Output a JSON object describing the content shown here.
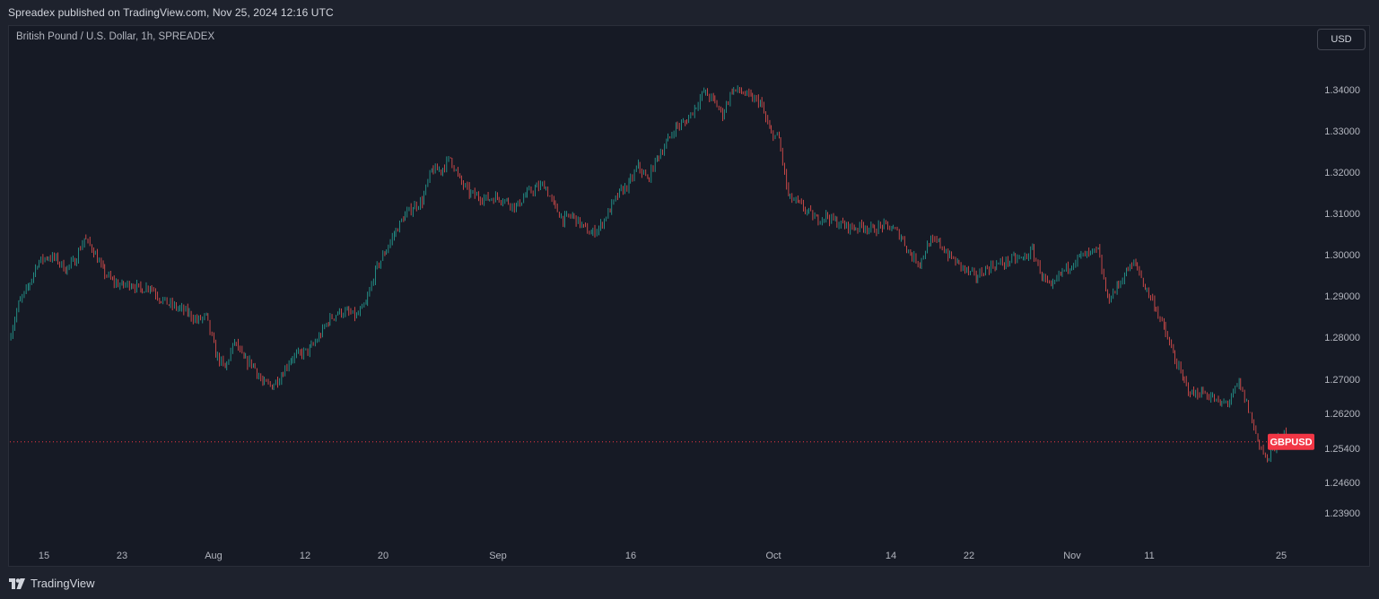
{
  "header": {
    "published": "Spreadex published on TradingView.com, Nov 25, 2024 12:16 UTC"
  },
  "symbol_title": "British Pound / U.S. Dollar, 1h, SPREADEX",
  "currency_button": "USD",
  "footer": {
    "brand": "TradingView"
  },
  "colors": {
    "up": "#26a69a",
    "down": "#ef5350",
    "background": "#161a25",
    "price_tag": "#f23645"
  },
  "chart_data": {
    "type": "candlestick",
    "symbol": "GBPUSD",
    "interval": "1h",
    "y_ticks": [
      "1.34000",
      "1.33000",
      "1.32000",
      "1.31000",
      "1.30000",
      "1.29000",
      "1.28000",
      "1.27000",
      "1.26200",
      "1.25400",
      "1.24600",
      "1.23900"
    ],
    "x_ticks": [
      "15",
      "23",
      "Aug",
      "12",
      "20",
      "Sep",
      "16",
      "Oct",
      "14",
      "22",
      "Nov",
      "11",
      "25"
    ],
    "last_price_label": "GBPUSD",
    "last_price": 1.2555,
    "close_path": [
      [
        "Jul 12",
        1.2795
      ],
      [
        "Jul 13",
        1.288
      ],
      [
        "Jul 14",
        1.292
      ],
      [
        "Jul 15",
        1.298
      ],
      [
        "Jul 16",
        1.2995
      ],
      [
        "Jul 17",
        1.299
      ],
      [
        "Jul 18",
        1.2965
      ],
      [
        "Jul 19",
        1.2985
      ],
      [
        "Jul 20",
        1.304
      ],
      [
        "Jul 21",
        1.301
      ],
      [
        "Jul 22",
        1.296
      ],
      [
        "Jul 23",
        1.2935
      ],
      [
        "Jul 24",
        1.2925
      ],
      [
        "Jul 25",
        1.293
      ],
      [
        "Jul 26",
        1.2915
      ],
      [
        "Jul 27",
        1.2925
      ],
      [
        "Jul 28",
        1.2895
      ],
      [
        "Jul 29",
        1.288
      ],
      [
        "Jul 30",
        1.287
      ],
      [
        "Jul 31",
        1.286
      ],
      [
        "Aug 1",
        1.284
      ],
      [
        "Aug 2",
        1.285
      ],
      [
        "Aug 3",
        1.276
      ],
      [
        "Aug 4",
        1.2725
      ],
      [
        "Aug 5",
        1.279
      ],
      [
        "Aug 6",
        1.2745
      ],
      [
        "Aug 7",
        1.2735
      ],
      [
        "Aug 8",
        1.269
      ],
      [
        "Aug 9",
        1.2685
      ],
      [
        "Aug 10",
        1.271
      ],
      [
        "Aug 11",
        1.275
      ],
      [
        "Aug 12",
        1.276
      ],
      [
        "Aug 13",
        1.277
      ],
      [
        "Aug 14",
        1.28
      ],
      [
        "Aug 15",
        1.284
      ],
      [
        "Aug 16",
        1.286
      ],
      [
        "Aug 17",
        1.286
      ],
      [
        "Aug 18",
        1.285
      ],
      [
        "Aug 19",
        1.288
      ],
      [
        "Aug 20",
        1.296
      ],
      [
        "Aug 21",
        1.3005
      ],
      [
        "Aug 22",
        1.305
      ],
      [
        "Aug 23",
        1.309
      ],
      [
        "Aug 24",
        1.3115
      ],
      [
        "Aug 25",
        1.313
      ],
      [
        "Aug 26",
        1.3205
      ],
      [
        "Aug 27",
        1.3205
      ],
      [
        "Aug 28",
        1.3235
      ],
      [
        "Aug 29",
        1.318
      ],
      [
        "Aug 30",
        1.315
      ],
      [
        "Aug 31",
        1.314
      ],
      [
        "Sep 1",
        1.3135
      ],
      [
        "Sep 2",
        1.314
      ],
      [
        "Sep 3",
        1.313
      ],
      [
        "Sep 4",
        1.3115
      ],
      [
        "Sep 5",
        1.3145
      ],
      [
        "Sep 6",
        1.316
      ],
      [
        "Sep 7",
        1.317
      ],
      [
        "Sep 8",
        1.312
      ],
      [
        "Sep 9",
        1.3085
      ],
      [
        "Sep 10",
        1.3095
      ],
      [
        "Sep 11",
        1.307
      ],
      [
        "Sep 12",
        1.305
      ],
      [
        "Sep 13",
        1.307
      ],
      [
        "Sep 14",
        1.311
      ],
      [
        "Sep 15",
        1.315
      ],
      [
        "Sep 16",
        1.317
      ],
      [
        "Sep 17",
        1.3215
      ],
      [
        "Sep 18",
        1.318
      ],
      [
        "Sep 19",
        1.3235
      ],
      [
        "Sep 20",
        1.327
      ],
      [
        "Sep 21",
        1.331
      ],
      [
        "Sep 22",
        1.332
      ],
      [
        "Sep 23",
        1.3355
      ],
      [
        "Sep 24",
        1.3395
      ],
      [
        "Sep 25",
        1.3375
      ],
      [
        "Sep 26",
        1.334
      ],
      [
        "Sep 27",
        1.34
      ],
      [
        "Sep 28",
        1.3395
      ],
      [
        "Sep 29",
        1.338
      ],
      [
        "Sep 30",
        1.337
      ],
      [
        "Oct 1",
        1.33
      ],
      [
        "Oct 2",
        1.328
      ],
      [
        "Oct 3",
        1.314
      ],
      [
        "Oct 4",
        1.3125
      ],
      [
        "Oct 5",
        1.3105
      ],
      [
        "Oct 6",
        1.3085
      ],
      [
        "Oct 7",
        1.3095
      ],
      [
        "Oct 8",
        1.308
      ],
      [
        "Oct 9",
        1.307
      ],
      [
        "Oct 10",
        1.3065
      ],
      [
        "Oct 11",
        1.307
      ],
      [
        "Oct 12",
        1.306
      ],
      [
        "Oct 13",
        1.307
      ],
      [
        "Oct 14",
        1.3065
      ],
      [
        "Oct 15",
        1.3045
      ],
      [
        "Oct 16",
        1.3
      ],
      [
        "Oct 17",
        1.298
      ],
      [
        "Oct 18",
        1.303
      ],
      [
        "Oct 19",
        1.303
      ],
      [
        "Oct 20",
        1.3
      ],
      [
        "Oct 21",
        1.298
      ],
      [
        "Oct 22",
        1.296
      ],
      [
        "Oct 23",
        1.2945
      ],
      [
        "Oct 24",
        1.2965
      ],
      [
        "Oct 25",
        1.2975
      ],
      [
        "Oct 26",
        1.298
      ],
      [
        "Oct 27",
        1.299
      ],
      [
        "Oct 28",
        1.299
      ],
      [
        "Oct 29",
        1.301
      ],
      [
        "Oct 30",
        1.295
      ],
      [
        "Oct 31",
        1.2915
      ],
      [
        "Nov 1",
        1.2955
      ],
      [
        "Nov 2",
        1.2975
      ],
      [
        "Nov 3",
        1.2995
      ],
      [
        "Nov 4",
        1.3
      ],
      [
        "Nov 5",
        1.301
      ],
      [
        "Nov 6",
        1.289
      ],
      [
        "Nov 7",
        1.292
      ],
      [
        "Nov 8",
        1.296
      ],
      [
        "Nov 9",
        1.298
      ],
      [
        "Nov 10",
        1.292
      ],
      [
        "Nov 11",
        1.288
      ],
      [
        "Nov 12",
        1.282
      ],
      [
        "Nov 13",
        1.276
      ],
      [
        "Nov 14",
        1.27
      ],
      [
        "Nov 15",
        1.2665
      ],
      [
        "Nov 16",
        1.267
      ],
      [
        "Nov 17",
        1.266
      ],
      [
        "Nov 18",
        1.264
      ],
      [
        "Nov 19",
        1.265
      ],
      [
        "Nov 20",
        1.269
      ],
      [
        "Nov 21",
        1.263
      ],
      [
        "Nov 22",
        1.256
      ],
      [
        "Nov 23",
        1.251
      ],
      [
        "Nov 24",
        1.255
      ],
      [
        "Nov 25",
        1.258
      ]
    ]
  }
}
